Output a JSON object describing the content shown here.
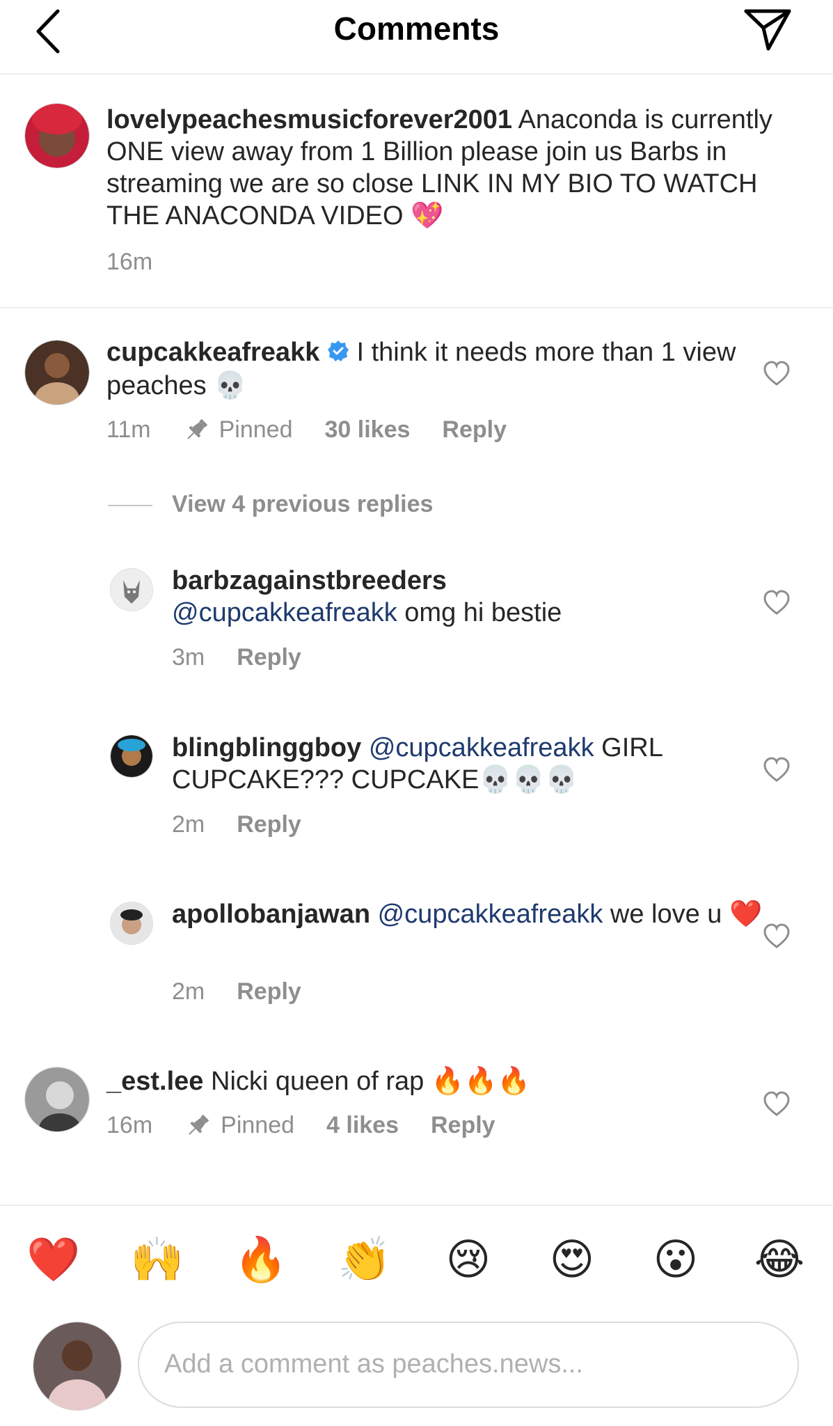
{
  "header": {
    "title": "Comments"
  },
  "caption": {
    "username": "lovelypeachesmusicforever2001",
    "text": " Anaconda is currently ONE view away from 1 Billion please join us Barbs in streaming we are so close LINK IN MY BIO TO WATCH THE ANACONDA VIDEO 💖",
    "time": "16m"
  },
  "comments": [
    {
      "username": "cupcakkeafreakk",
      "verified_icon": "verified-badge",
      "text": " I think it needs more than 1 view peaches 💀",
      "time": "11m",
      "pinned_label": "Pinned",
      "likes": "30 likes",
      "reply_label": "Reply"
    },
    {
      "username": "_est.lee",
      "text": " Nicki queen of rap 🔥🔥🔥",
      "time": "16m",
      "pinned_label": "Pinned",
      "likes": "4 likes",
      "reply_label": "Reply"
    }
  ],
  "view_replies": "View 4 previous replies",
  "replies": [
    {
      "username": "barbzagainstbreeders",
      "mention": "@cupcakkeafreakk",
      "text": " omg hi bestie",
      "time": "3m",
      "reply_label": "Reply"
    },
    {
      "username": "blingblinggboy",
      "mention": "@cupcakkeafreakk",
      "text": " GIRL CUPCAKE??? CUPCAKE💀💀💀",
      "time": "2m",
      "reply_label": "Reply"
    },
    {
      "username": "apollobanjawan",
      "mention": "@cupcakkeafreakk",
      "text": " we love u ❤️",
      "time": "2m",
      "reply_label": "Reply"
    }
  ],
  "emoji_bar": [
    "❤️",
    "🙌",
    "🔥",
    "👏",
    "😢",
    "😍",
    "😮",
    "😂"
  ],
  "composer": {
    "placeholder": "Add a comment as peaches.news..."
  },
  "colors": {
    "mention": "#1e3a6e",
    "verified": "#3897f0",
    "muted": "#8e8e8e"
  }
}
